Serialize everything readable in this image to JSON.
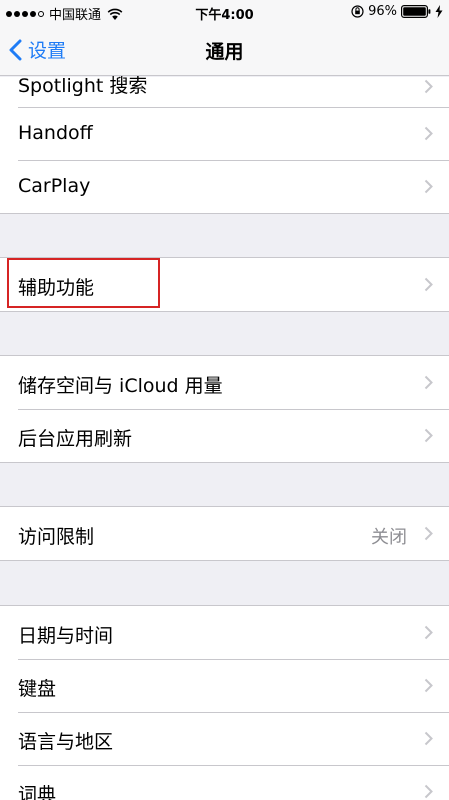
{
  "status_bar": {
    "carrier": "中国联通",
    "time": "下午4:00",
    "battery_percent": "96%"
  },
  "nav_bar": {
    "back_label": "设置",
    "title": "通用"
  },
  "groups": [
    {
      "rows": [
        {
          "label": "Spotlight 搜索"
        },
        {
          "label": "Handoff"
        },
        {
          "label": "CarPlay"
        }
      ]
    },
    {
      "rows": [
        {
          "label": "辅助功能"
        }
      ]
    },
    {
      "rows": [
        {
          "label": "储存空间与 iCloud 用量"
        },
        {
          "label": "后台应用刷新"
        }
      ]
    },
    {
      "rows": [
        {
          "label": "访问限制",
          "value": "关闭"
        }
      ]
    },
    {
      "rows": [
        {
          "label": "日期与时间"
        },
        {
          "label": "键盘"
        },
        {
          "label": "语言与地区"
        },
        {
          "label": "词典"
        }
      ]
    }
  ],
  "colors": {
    "accent": "#1f7cf6",
    "highlight": "#d62424",
    "background": "#efeff4"
  }
}
